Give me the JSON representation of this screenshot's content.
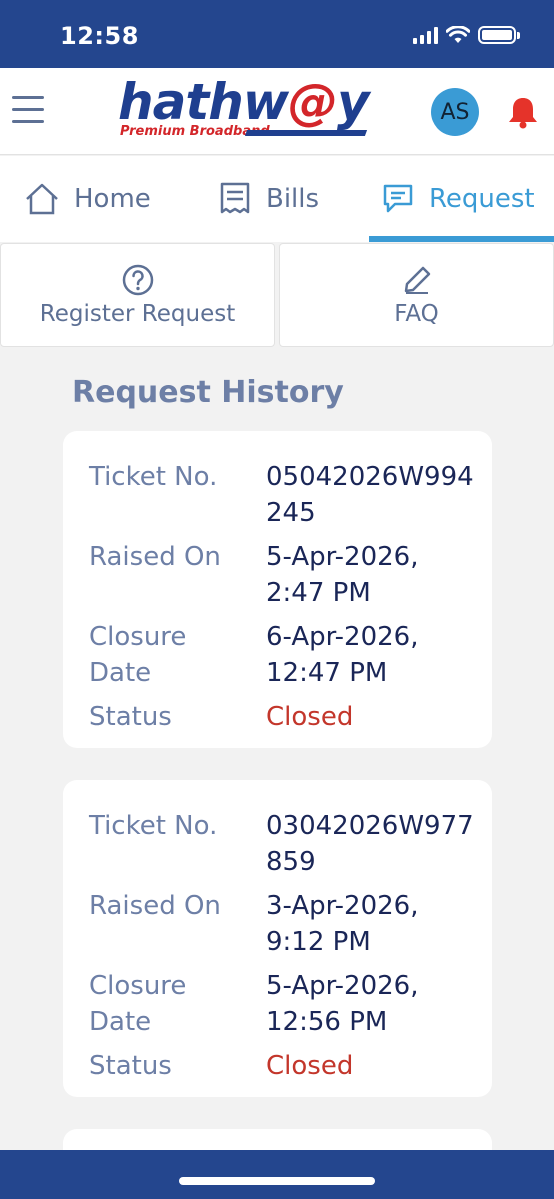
{
  "status_bar": {
    "time": "12:58"
  },
  "header": {
    "brand_part1": "hathw",
    "brand_at": "@",
    "brand_part2": "y",
    "tagline": "Premium Broadband",
    "avatar_initials": "AS"
  },
  "tabs": [
    {
      "label": "Home",
      "icon": "home-icon",
      "active": false
    },
    {
      "label": "Bills",
      "icon": "bill-icon",
      "active": false
    },
    {
      "label": "Request",
      "icon": "chat-icon",
      "active": true
    }
  ],
  "actions": [
    {
      "label": "Register Request",
      "icon": "question-circle-icon"
    },
    {
      "label": "FAQ",
      "icon": "pencil-icon"
    }
  ],
  "section_title": "Request History",
  "labels": {
    "ticket": "Ticket No.",
    "raised": "Raised On",
    "closure": "Closure Date",
    "status": "Status"
  },
  "requests": [
    {
      "ticket_no": "05042026W994245",
      "raised_on": "5-Apr-2026, 2:47 PM",
      "closure_date": "6-Apr-2026, 12:47 PM",
      "status": "Closed"
    },
    {
      "ticket_no": "03042026W977859",
      "raised_on": "3-Apr-2026, 9:12 PM",
      "closure_date": "5-Apr-2026, 12:56 PM",
      "status": "Closed"
    }
  ],
  "colors": {
    "brand_blue": "#24468e",
    "accent": "#3a9bd5",
    "closed_status": "#c3362b",
    "bell": "#e5332a"
  }
}
